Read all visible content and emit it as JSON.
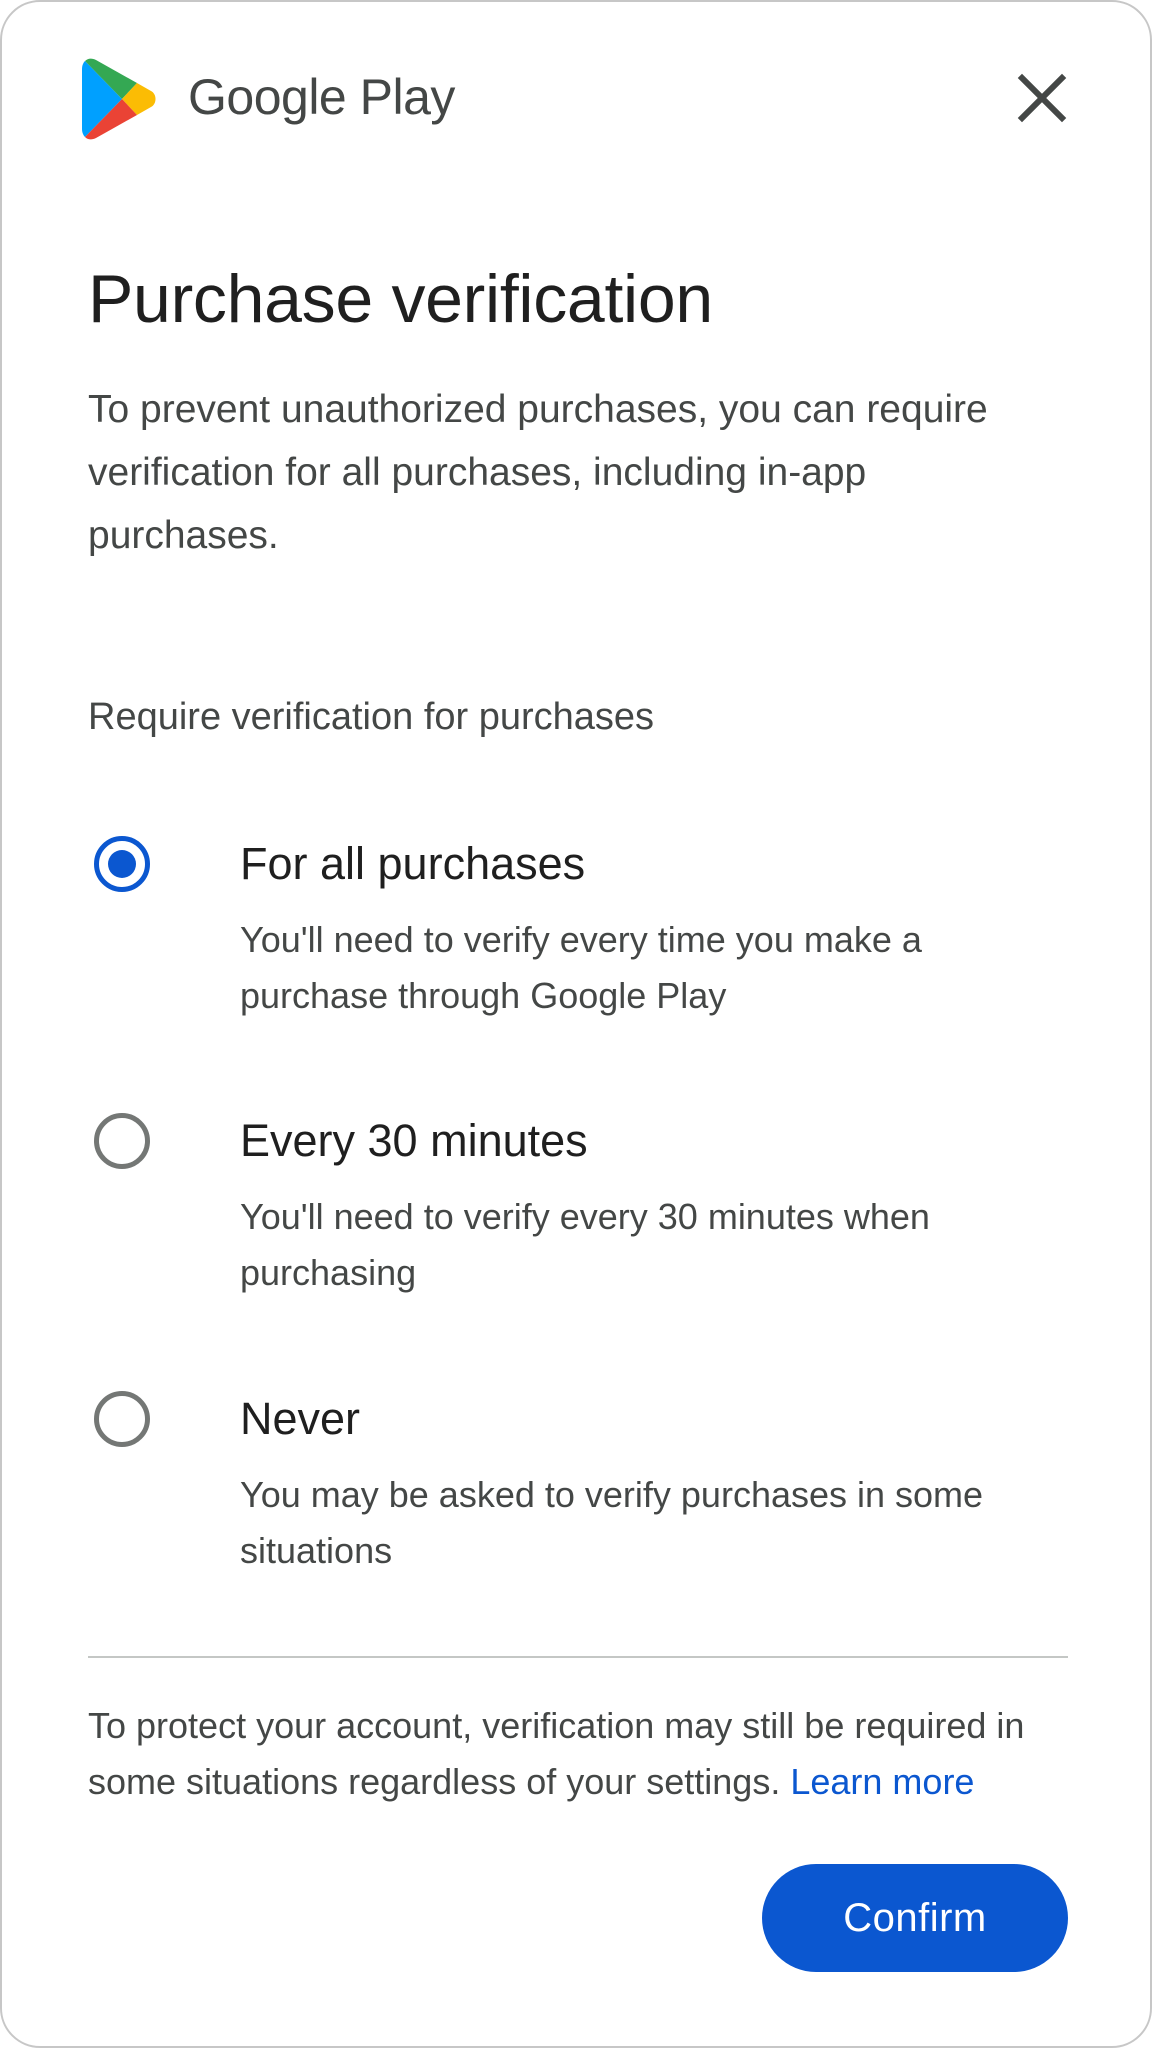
{
  "header": {
    "brand": "Google Play",
    "logo_icon": "google-play-icon",
    "close_icon": "close-icon"
  },
  "dialog": {
    "title": "Purchase verification",
    "description": "To prevent unauthorized purchases, you can require verification for all purchases, including in-app purchases.",
    "section_label": "Require verification for purchases",
    "options": [
      {
        "title": "For all purchases",
        "description": "You'll need to verify every time you make a purchase through Google Play",
        "selected": true
      },
      {
        "title": "Every 30 minutes",
        "description": "You'll need to verify every 30 minutes when purchasing",
        "selected": false
      },
      {
        "title": "Never",
        "description": "You may be asked to verify purchases in some situations",
        "selected": false
      }
    ],
    "footnote": "To protect your account, verification may still be required in some situations regardless of your settings.",
    "learn_more": "Learn more",
    "confirm_label": "Confirm"
  },
  "colors": {
    "accent": "#0b57d0",
    "text_primary": "#1f1f1f",
    "text_secondary": "#444746",
    "radio_unselected": "#747775",
    "divider": "#c4c7c5"
  }
}
